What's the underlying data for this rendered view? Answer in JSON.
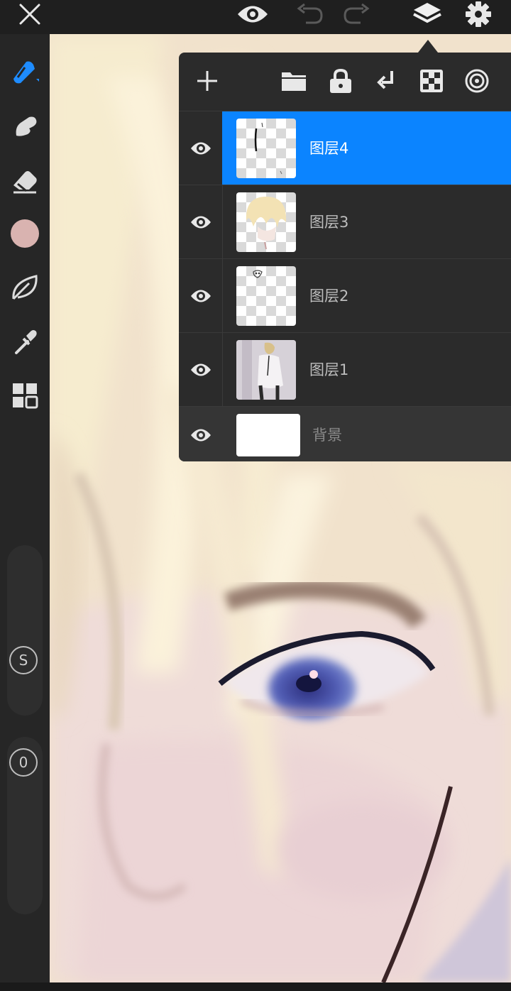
{
  "colors": {
    "accent": "#0b84ff",
    "panel_bg": "#2b2b2b",
    "toolbar_bg": "#262626",
    "current_color": "#d9b3b0"
  },
  "top_bar": {
    "icons": [
      "close-icon",
      "eye-icon",
      "undo-icon",
      "redo-icon",
      "layers-icon",
      "settings-gear-icon"
    ]
  },
  "left_toolbar": {
    "tools": [
      "pen-tool-icon",
      "smudge-tool-icon",
      "eraser-tool-icon",
      "color-swatch",
      "leaf-brush-icon",
      "eyedropper-icon",
      "grid-menu-icon"
    ],
    "size_button_label": "S",
    "opacity_button_label": "0"
  },
  "layers_panel": {
    "header_icons": [
      "add-layer-icon",
      "folder-icon",
      "lock-icon",
      "merge-down-icon",
      "checker-transparency-icon",
      "clip-mask-icon"
    ],
    "layers": [
      {
        "name": "图层4",
        "selected": true,
        "visible": true
      },
      {
        "name": "图层3",
        "selected": false,
        "visible": true
      },
      {
        "name": "图层2",
        "selected": false,
        "visible": true
      },
      {
        "name": "图层1",
        "selected": false,
        "visible": true
      }
    ],
    "background_layer": {
      "name": "背景",
      "visible": true
    }
  }
}
